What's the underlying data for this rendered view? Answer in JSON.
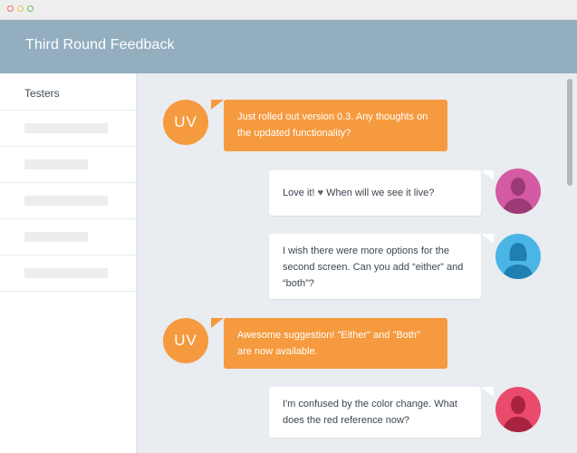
{
  "window": {
    "title": "Third Round Feedback"
  },
  "sidebar": {
    "heading": "Testers",
    "placeholder_count": 5
  },
  "avatars": {
    "uv_initials": "UV",
    "tester_colors": [
      "#d35aa3",
      "#4bb6e6",
      "#ea4a6b"
    ]
  },
  "messages": [
    {
      "from": "UV",
      "text": "Just rolled out version 0.3. Any thoughts on the updated functionality?"
    },
    {
      "from": "tester-1",
      "text_before": "Love it!",
      "icon": "heart-icon",
      "text_after": "When will we see it live?"
    },
    {
      "from": "tester-2",
      "text": "I wish there were more options for the second screen. Can you add “either” and “both”?"
    },
    {
      "from": "UV",
      "text": "Awesome suggestion! \"Either\" and \"Both\" are now available."
    },
    {
      "from": "tester-3",
      "text": "I'm confused by the color change. What does the red reference now?"
    }
  ],
  "colors": {
    "accent_orange": "#f59a3e",
    "header_blue": "#92aebf",
    "chat_background": "#e9ecf1"
  }
}
